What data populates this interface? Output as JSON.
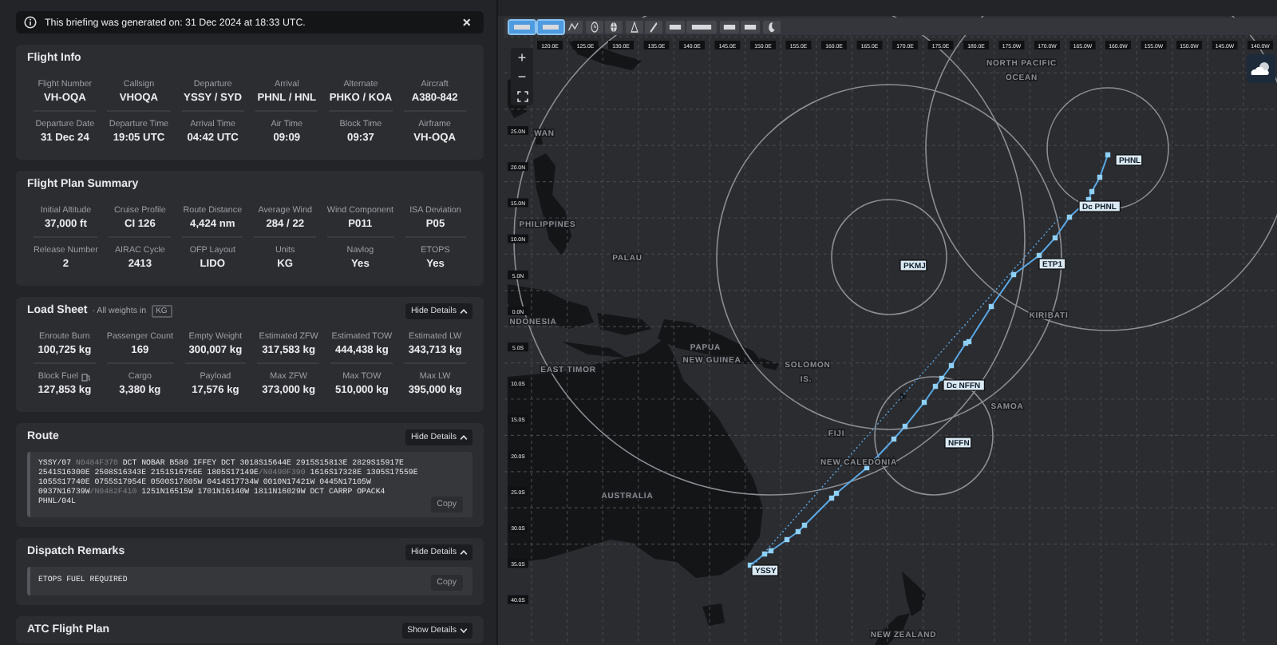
{
  "banner": {
    "text": "This briefing was generated on: 31 Dec 2024 at 18:33 UTC.",
    "close": "×"
  },
  "sections": [
    {
      "kind": "stats",
      "title": "Flight Info",
      "rows": [
        [
          {
            "label": "Flight Number",
            "value": "VH-OQA"
          },
          {
            "label": "Callsign",
            "value": "VHOQA"
          },
          {
            "label": "Departure",
            "value": "YSSY / SYD"
          },
          {
            "label": "Arrival",
            "value": "PHNL / HNL"
          },
          {
            "label": "Alternate",
            "value": "PHKO / KOA"
          },
          {
            "label": "Aircraft",
            "value": "A380-842"
          }
        ],
        [
          {
            "label": "Departure Date",
            "value": "31 Dec 24"
          },
          {
            "label": "Departure Time",
            "value": "19:05 UTC"
          },
          {
            "label": "Arrival Time",
            "value": "04:42 UTC"
          },
          {
            "label": "Air Time",
            "value": "09:09"
          },
          {
            "label": "Block Time",
            "value": "09:37"
          },
          {
            "label": "Airframe",
            "value": "VH-OQA"
          }
        ]
      ]
    },
    {
      "kind": "stats",
      "title": "Flight Plan Summary",
      "rows": [
        [
          {
            "label": "Initial Altitude",
            "value": "37,000 ft"
          },
          {
            "label": "Cruise Profile",
            "value": "CI 126"
          },
          {
            "label": "Route Distance",
            "value": "4,424 nm"
          },
          {
            "label": "Average Wind",
            "value": "284 / 22"
          },
          {
            "label": "Wind Component",
            "value": "P011"
          },
          {
            "label": "ISA Deviation",
            "value": "P05"
          }
        ],
        [
          {
            "label": "Release Number",
            "value": "2"
          },
          {
            "label": "AIRAC Cycle",
            "value": "2413"
          },
          {
            "label": "OFP Layout",
            "value": "LIDO"
          },
          {
            "label": "Units",
            "value": "KG"
          },
          {
            "label": "Navlog",
            "value": "Yes"
          },
          {
            "label": "ETOPS",
            "value": "Yes"
          }
        ]
      ]
    },
    {
      "kind": "stats",
      "title": "Load Sheet",
      "note": "· All weights in",
      "unit": "KG",
      "toggle": {
        "label": "Hide Details",
        "expanded": true
      },
      "rows": [
        [
          {
            "label": "Enroute Burn",
            "value": "100,725 kg"
          },
          {
            "label": "Passenger Count",
            "value": "169"
          },
          {
            "label": "Empty Weight",
            "value": "300,007 kg"
          },
          {
            "label": "Estimated ZFW",
            "value": "317,583 kg"
          },
          {
            "label": "Estimated TOW",
            "value": "444,438 kg"
          },
          {
            "label": "Estimated LW",
            "value": "343,713 kg"
          }
        ],
        [
          {
            "label": "Block Fuel",
            "value": "127,853 kg",
            "icon": true
          },
          {
            "label": "Cargo",
            "value": "3,380 kg"
          },
          {
            "label": "Payload",
            "value": "17,576 kg"
          },
          {
            "label": "Max ZFW",
            "value": "373,000 kg"
          },
          {
            "label": "Max TOW",
            "value": "510,000 kg"
          },
          {
            "label": "Max LW",
            "value": "395,000 kg"
          }
        ]
      ]
    },
    {
      "kind": "code",
      "title": "Route",
      "toggle": {
        "label": "Hide Details",
        "expanded": true
      },
      "copy": "Copy",
      "segments": [
        {
          "kind": "plain",
          "text": "YSSY/07 "
        },
        {
          "kind": "speed_level",
          "text": "N0484F370"
        },
        {
          "kind": "plain",
          "text": " DCT NOBAR B580 IFFEY DCT 3018S15644E 2915S15813E 2829S15917E 2541S16300E 2508S16343E 2151S16756E 1805S17149E"
        },
        {
          "kind": "speed_level",
          "text": "/N0490F390"
        },
        {
          "kind": "plain",
          "text": " 1616S17328E 1305S17559E 1055S17740E 0755S17954E 0500S17805W 0414S17734W 0010N17421W 0445N17105W 0937N16739W"
        },
        {
          "kind": "speed_level",
          "text": "/N0482F410"
        },
        {
          "kind": "plain",
          "text": " 1251N16515W 1701N16140W 1811N16029W DCT CARRP OPACK4 PHNL/04L"
        }
      ]
    },
    {
      "kind": "code",
      "title": "Dispatch Remarks",
      "toggle": {
        "label": "Hide Details",
        "expanded": true
      },
      "copy": "Copy",
      "segments": [
        {
          "kind": "plain",
          "text": "ETOPS FUEL REQUIRED"
        }
      ]
    },
    {
      "kind": "code",
      "title": "ATC Flight Plan",
      "toggle": {
        "label": "Show Details",
        "expanded": false
      }
    }
  ],
  "map": {
    "toolbar": [
      {
        "kind": "label",
        "selected": true
      },
      {
        "kind": "label",
        "selected": true
      },
      {
        "kind": "route",
        "selected": false
      },
      {
        "kind": "clock",
        "selected": false
      },
      {
        "kind": "globe",
        "selected": false
      },
      {
        "kind": "triangle",
        "selected": false
      },
      {
        "kind": "pen",
        "selected": false
      },
      {
        "kind": "label",
        "selected": false
      },
      {
        "kind": "label",
        "selected": false
      },
      {
        "kind": "label",
        "selected": false
      },
      {
        "kind": "label",
        "selected": false
      },
      {
        "kind": "moon",
        "selected": false
      }
    ],
    "zoom_in": "+",
    "zoom_out": "−",
    "longitudes": [
      "120.0E",
      "125.0E",
      "130.0E",
      "135.0E",
      "140.0E",
      "145.0E",
      "150.0E",
      "155.0E",
      "160.0E",
      "165.0E",
      "170.0E",
      "175.0E",
      "180.0E",
      "175.0W",
      "170.0W",
      "165.0W",
      "160.0W",
      "155.0W",
      "150.0W",
      "145.0W",
      "140.0W"
    ],
    "latitudes": [
      "25.0N",
      "20.0N",
      "15.0N",
      "10.0N",
      "5.0N",
      "0.0N",
      "5.0S",
      "10.0S",
      "15.0S",
      "20.0S",
      "25.0S",
      "30.0S",
      "35.0S",
      "40.0S"
    ],
    "regions": [
      "NORTH PACIFIC",
      "OCEAN",
      "WAN",
      "PHILIPPINES",
      "PALAU",
      "NDONESIA",
      "PAPUA",
      "NEW GUINEA",
      "SOLOMON",
      "IS.",
      "KIRIBATI",
      "EAST TIMOR",
      "FIJI",
      "NEW CALEDONIA",
      "SAMOA",
      "AUSTRALIA",
      "NEW ZEALAND"
    ],
    "waypoints": [
      "PHNL",
      "Dc PHNL",
      "ETP1",
      "PKMJ",
      "Dc NFFN",
      "NFFN",
      "YSSY"
    ]
  }
}
